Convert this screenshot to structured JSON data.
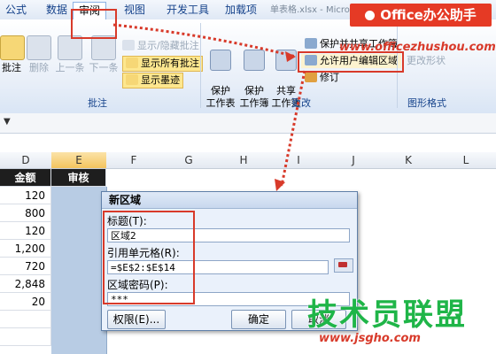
{
  "ribbon": {
    "tabs": [
      "公式",
      "数据",
      "审阅",
      "视图",
      "开发工具",
      "加载项"
    ],
    "window_title": "单表格.xlsx - Microsoft Excel",
    "comment_group": {
      "label": "批注",
      "new": "批注",
      "delete": "删除",
      "prev": "上一条",
      "next": "下一条",
      "show_hide": "显示/隐藏批注",
      "show_all": "显示所有批注",
      "show_ink": "显示墨迹"
    },
    "changes_group": {
      "label": "更改",
      "protect_sheet": "保护\n工作表",
      "protect_workbook": "保护\n工作簿",
      "share_workbook": "共享\n工作簿",
      "protect_share": "保护并共享工作簿",
      "allow_edit_ranges": "允许用户编辑区域",
      "track_changes": "修订"
    },
    "shape_group": {
      "label": "图形格式",
      "change_shape": "更改形状"
    }
  },
  "logo": {
    "text": "Office办公助手",
    "site": "www.officezhushou.com"
  },
  "formula_bar": {
    "qa_glyph": "▼"
  },
  "grid": {
    "columns": [
      "D",
      "E",
      "F",
      "G",
      "H",
      "I",
      "J",
      "K",
      "L"
    ],
    "header_row": {
      "D": "金额",
      "E": "审核"
    },
    "values_D": [
      "120",
      "800",
      "120",
      "1,200",
      "720",
      "2,848",
      "20"
    ]
  },
  "dialog": {
    "title": "新区域",
    "title_label": "标题(T):",
    "title_value": "区域2",
    "ref_label": "引用单元格(R):",
    "ref_value": "=$E$2:$E$14",
    "pwd_label": "区域密码(P):",
    "pwd_value": "***",
    "perm_button": "权限(E)...",
    "ok_button": "确定",
    "cancel_button": "取消"
  },
  "watermark": {
    "text": "技术员联盟",
    "url": "www.jsgho.com"
  },
  "colors": {
    "accent_red": "#d83a2a",
    "ribbon_blue": "#15428b",
    "watermark_green": "#1fb548"
  }
}
